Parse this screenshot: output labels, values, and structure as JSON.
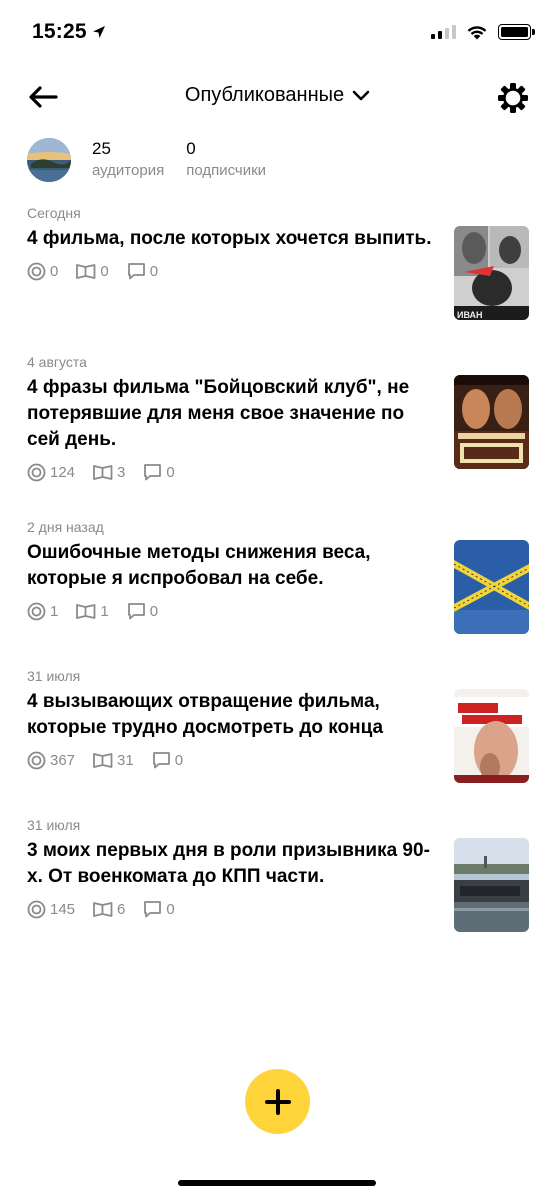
{
  "status_bar": {
    "time": "15:25"
  },
  "header": {
    "title": "Опубликованные"
  },
  "profile": {
    "stats": [
      {
        "value": "25",
        "label": "аудитория"
      },
      {
        "value": "0",
        "label": "подписчики"
      }
    ]
  },
  "articles": [
    {
      "date": "Сегодня",
      "title": "4 фильма, после которых хочется выпить.",
      "views": "0",
      "reads": "0",
      "comments": "0"
    },
    {
      "date": "4 августа",
      "title": "4 фразы фильма \"Бойцовский клуб\", не потерявшие для меня свое значение по сей день.",
      "views": "124",
      "reads": "3",
      "comments": "0"
    },
    {
      "date": "2 дня назад",
      "title": "Ошибочные методы снижения веса, которые я испробовал на себе.",
      "views": "1",
      "reads": "1",
      "comments": "0"
    },
    {
      "date": "31 июля",
      "title": "4 вызывающих отвращение фильма, которые трудно досмотреть до конца",
      "views": "367",
      "reads": "31",
      "comments": "0"
    },
    {
      "date": "31 июля",
      "title": "3 моих первых дня в роли призывника 90-х. От военкомата до КПП части.",
      "views": "145",
      "reads": "6",
      "comments": "0"
    }
  ],
  "colors": {
    "accent": "#ffd43b",
    "muted_text": "#8a8a8a"
  },
  "icons": {
    "views": "eye-circle-icon",
    "reads": "open-book-icon",
    "comments": "speech-bubble-icon",
    "add": "plus-icon"
  }
}
